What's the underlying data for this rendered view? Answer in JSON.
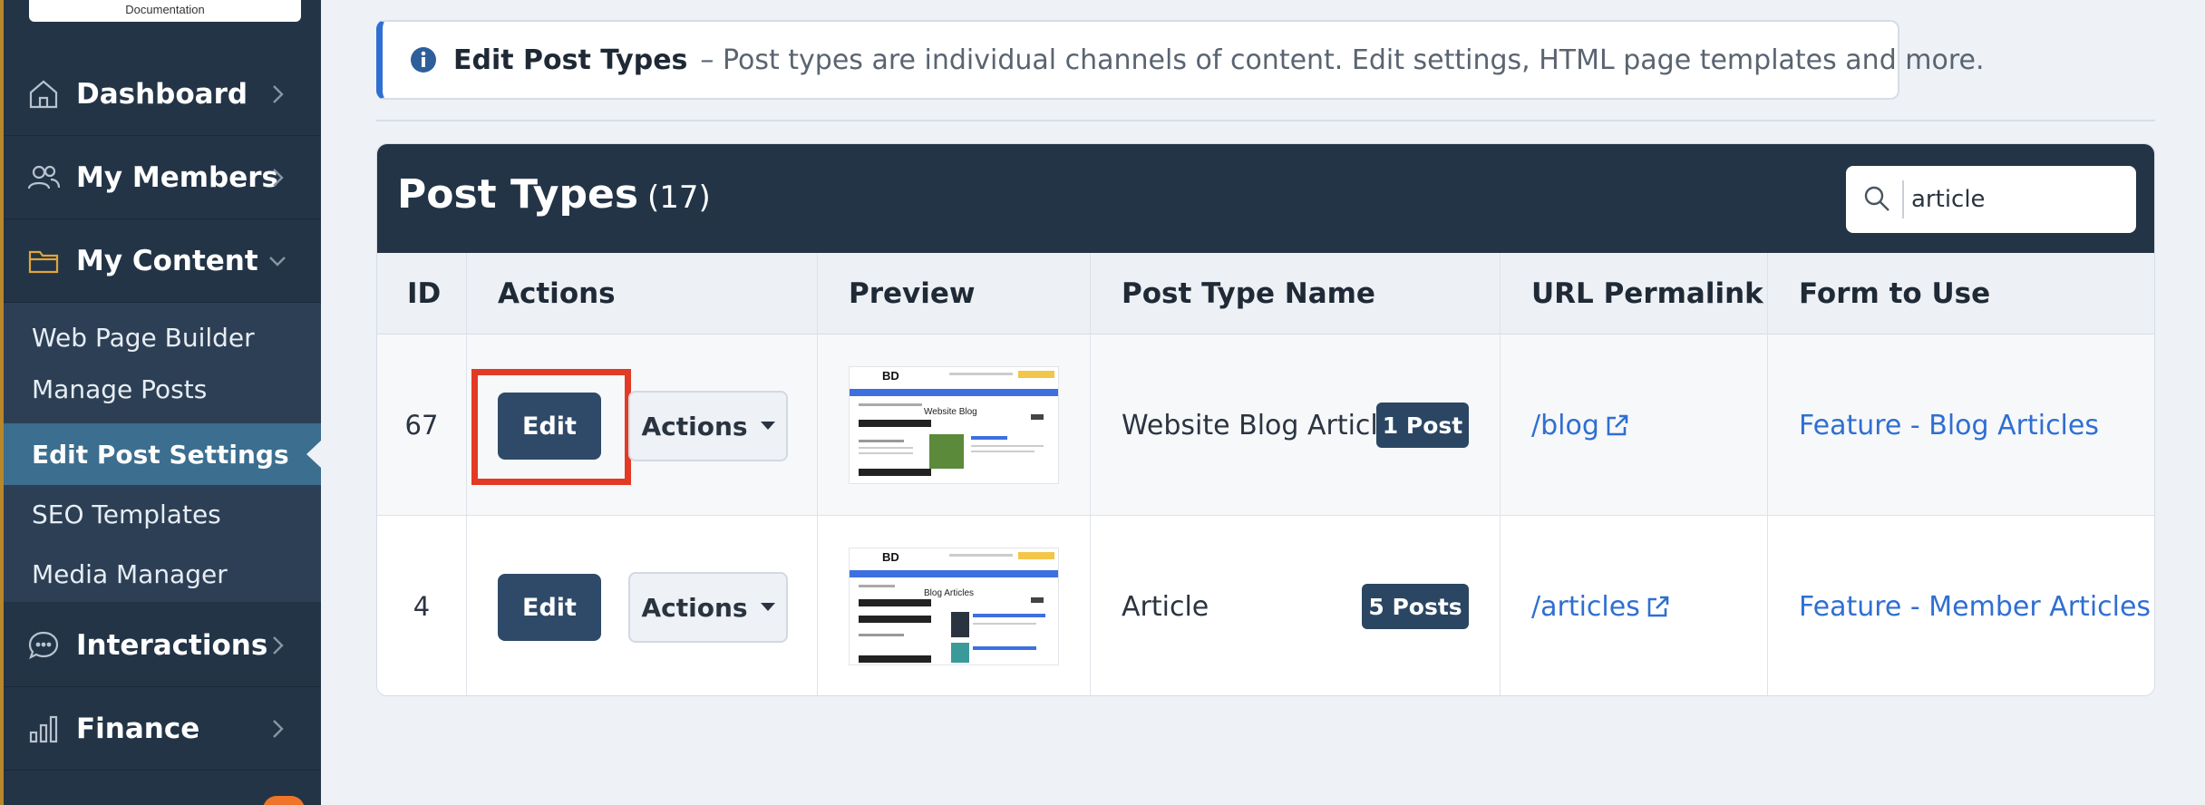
{
  "sidebar": {
    "logo_text": "Documentation",
    "nav": [
      {
        "label": "Dashboard",
        "icon": "home-icon"
      },
      {
        "label": "My Members",
        "icon": "users-icon"
      },
      {
        "label": "My Content",
        "icon": "folder-icon"
      }
    ],
    "submenu": [
      {
        "label": "Web Page Builder"
      },
      {
        "label": "Manage Posts"
      },
      {
        "label": "Edit Post Settings",
        "active": true
      },
      {
        "label": "SEO Templates"
      },
      {
        "label": "Media Manager"
      }
    ],
    "nav_bottom": [
      {
        "label": "Interactions",
        "icon": "chat-icon"
      },
      {
        "label": "Finance",
        "icon": "bar-chart-icon"
      }
    ]
  },
  "banner": {
    "title": "Edit Post Types",
    "text": "– Post types are individual channels of content. Edit settings, HTML page templates and more."
  },
  "panel": {
    "title": "Post Types",
    "count": "(17)",
    "search_value": "article"
  },
  "table": {
    "headers": [
      "ID",
      "Actions",
      "Preview",
      "Post Type Name",
      "URL Permalink",
      "Form to Use"
    ],
    "edit_label": "Edit",
    "actions_label": "Actions",
    "rows": [
      {
        "id": "67",
        "name": "Website Blog Article",
        "badge": "1 Post",
        "permalink": "/blog",
        "form": "Feature - Blog Articles",
        "preview_heading": "Website Blog"
      },
      {
        "id": "4",
        "name": "Article",
        "badge": "5 Posts",
        "permalink": "/articles",
        "form": "Feature - Member Articles",
        "preview_heading": "Blog Articles"
      }
    ]
  },
  "colors": {
    "sidebar_bg": "#233446",
    "active_item": "#3b6e8f",
    "primary_button": "#2e4a68",
    "link": "#2f6fd1",
    "highlight": "#e23a24"
  }
}
